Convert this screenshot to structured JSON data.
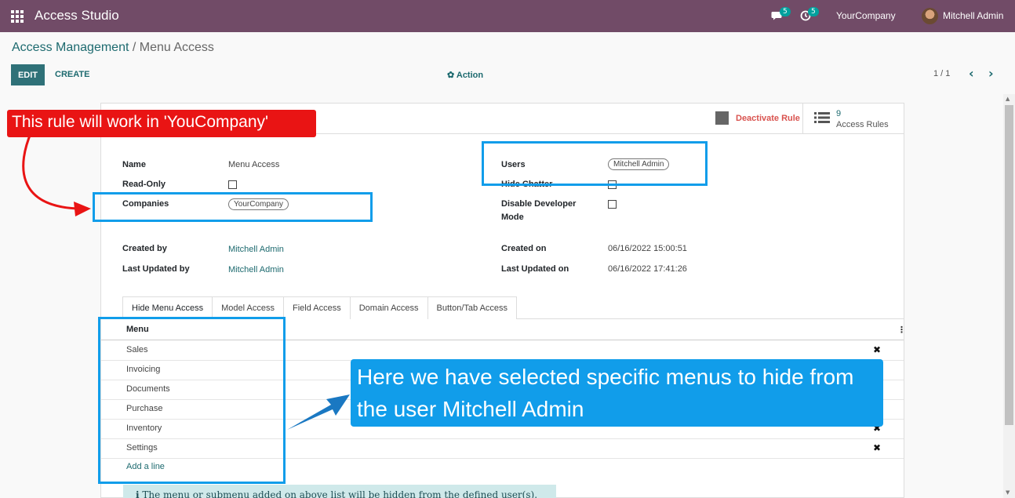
{
  "navbar": {
    "app_title": "Access Studio",
    "messages_count": "5",
    "activities_count": "5",
    "company": "YourCompany",
    "user": "Mitchell Admin"
  },
  "breadcrumb": {
    "parent": "Access Management",
    "separator": "/",
    "current": "Menu Access"
  },
  "toolbar": {
    "edit_label": "EDIT",
    "create_label": "CREATE",
    "action_label": "Action",
    "pager": "1 / 1"
  },
  "smart_buttons": {
    "deactivate_label": "Deactivate Rule",
    "access_rules_count": "9",
    "access_rules_label": "Access Rules"
  },
  "form": {
    "name_label": "Name",
    "name_value": "Menu Access",
    "readonly_label": "Read-Only",
    "companies_label": "Companies",
    "companies_tag": "YourCompany",
    "users_label": "Users",
    "users_tag": "Mitchell Admin",
    "hide_chatter_label": "Hide Chatter",
    "disable_dev_label_1": "Disable Developer",
    "disable_dev_label_2": "Mode",
    "created_by_label": "Created by",
    "created_by_value": "Mitchell Admin",
    "updated_by_label": "Last Updated by",
    "updated_by_value": "Mitchell Admin",
    "created_on_label": "Created on",
    "created_on_value": "06/16/2022 15:00:51",
    "updated_on_label": "Last Updated on",
    "updated_on_value": "06/16/2022 17:41:26"
  },
  "tabs": [
    {
      "label": "Hide Menu Access"
    },
    {
      "label": "Model Access"
    },
    {
      "label": "Field Access"
    },
    {
      "label": "Domain Access"
    },
    {
      "label": "Button/Tab Access"
    }
  ],
  "menu_list": {
    "header": "Menu",
    "rows": [
      "Sales",
      "Invoicing",
      "Documents",
      "Purchase",
      "Inventory",
      "Settings"
    ],
    "delete_glyph": "✖",
    "add_line": "Add a line"
  },
  "info_text": "The menu or submenu added on above list will be hidden from the defined user(s).",
  "annotations": {
    "red_callout": "This rule will work in 'YouCompany'",
    "blue_callout_line1": "Here we have selected specific menus to hide from",
    "blue_callout_line2": "the user Mitchell Admin"
  },
  "colors": {
    "navbar": "#714b67",
    "link": "#1d6a6f",
    "annotation_red": "#e91414",
    "annotation_blue": "#119dea"
  }
}
